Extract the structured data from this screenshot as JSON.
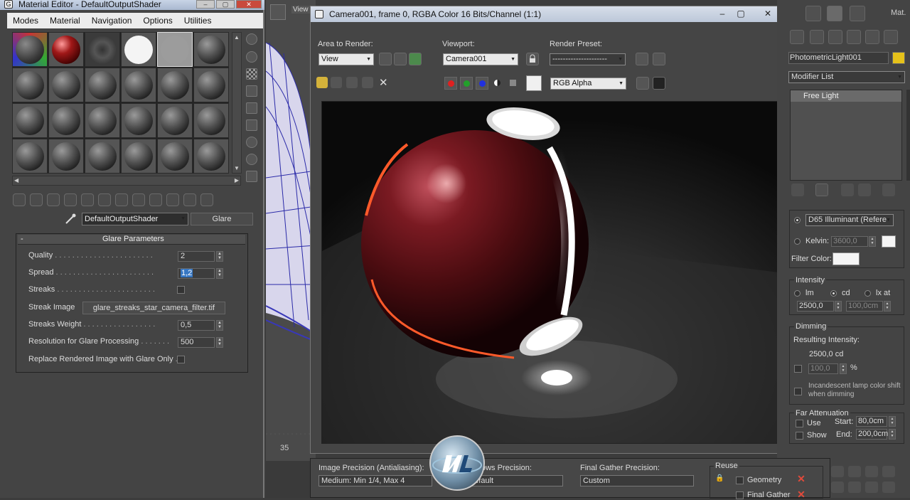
{
  "material_editor": {
    "title": "Material Editor - DefaultOutputShader",
    "menu": [
      "Modes",
      "Material",
      "Navigation",
      "Options",
      "Utilities"
    ],
    "shader_name": "DefaultOutputShader",
    "shader_type": "Glare",
    "glare_parameters": {
      "header": "Glare Parameters",
      "quality_label": "Quality",
      "quality_value": "2",
      "spread_label": "Spread",
      "spread_value": "1,2",
      "streaks_label": "Streaks",
      "streak_image_label": "Streak Image",
      "streak_image_value": "glare_streaks_star_camera_filter.tif",
      "streaks_weight_label": "Streaks Weight",
      "streaks_weight_value": "0,5",
      "resolution_label": "Resolution for Glare Processing",
      "resolution_value": "500",
      "replace_label": "Replace Rendered Image with Glare Only"
    }
  },
  "viewport": {
    "view_label": "View",
    "frame_number": "35"
  },
  "render_window": {
    "title": "Camera001, frame 0, RGBA Color 16 Bits/Channel (1:1)",
    "area_to_render_label": "Area to Render:",
    "area_to_render_value": "View",
    "viewport_label": "Viewport:",
    "viewport_value": "Camera001",
    "render_preset_label": "Render Preset:",
    "render_preset_value": "---------------------",
    "channel_value": "RGB Alpha"
  },
  "bottom_panel": {
    "image_precision_label": "Image Precision (Antialiasing):",
    "image_precision_value": "Medium: Min 1/4, Max 4",
    "shadows_precision_label": "ows Precision:",
    "shadows_precision_value": "1X - Default",
    "final_gather_label": "Final Gather Precision:",
    "final_gather_value": "Custom",
    "reuse_label": "Reuse",
    "geometry_label": "Geometry",
    "final_gather_item": "Final Gather"
  },
  "right_panel": {
    "mat_label": "Mat.",
    "object_name": "PhotometricLight001",
    "modifier_list": "Modifier List",
    "stack_item": "Free Light",
    "illuminant_value": "D65 Illuminant (Refere",
    "kelvin_label": "Kelvin:",
    "kelvin_value": "3600,0",
    "filter_color_label": "Filter Color:",
    "intensity_label": "Intensity",
    "unit_lm": "lm",
    "unit_cd": "cd",
    "unit_lxat": "lx at",
    "intensity_value": "2500,0",
    "distance_value": "100,0cm",
    "dimming_label": "Dimming",
    "resulting_intensity_label": "Resulting Intensity:",
    "resulting_intensity_value": "2500,0 cd",
    "dimming_value": "100,0",
    "percent": "%",
    "incandescent_label": "Incandescent lamp color shift when dimming",
    "far_attenuation_label": "Far Attenuation",
    "use_label": "Use",
    "show_label": "Show",
    "start_label": "Start:",
    "start_value": "80,0cm",
    "end_label": "End:",
    "end_value": "200,0cm"
  },
  "colors": {
    "accent_red": "#c94a3c",
    "selection_blue": "#3777c3"
  }
}
